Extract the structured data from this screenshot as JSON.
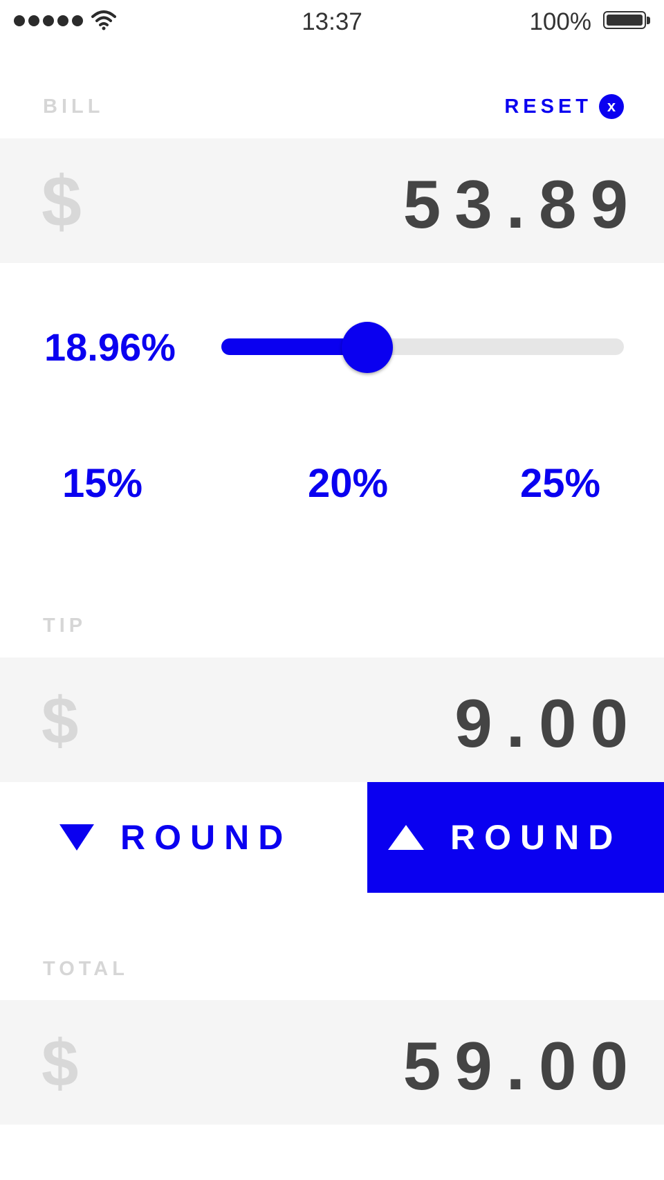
{
  "status_bar": {
    "time": "13:37",
    "battery_percent": "100%",
    "signal_bars": 5,
    "wifi_icon": "wifi-icon",
    "battery_icon": "battery-full-icon"
  },
  "bill": {
    "label": "BILL",
    "reset_label": "RESET",
    "reset_icon_glyph": "x",
    "currency_symbol": "$",
    "amount": "53.89"
  },
  "tip_slider": {
    "percent_label": "18.96%",
    "value_fraction": 0.3625
  },
  "presets": [
    {
      "label": "15%"
    },
    {
      "label": "20%"
    },
    {
      "label": "25%"
    }
  ],
  "tip": {
    "label": "TIP",
    "currency_symbol": "$",
    "amount": "9.00"
  },
  "round": {
    "down_label": "ROUND",
    "up_label": "ROUND",
    "active": "up"
  },
  "total": {
    "label": "TOTAL",
    "currency_symbol": "$",
    "amount": "59.00"
  },
  "colors": {
    "accent": "#0a00f0",
    "amount_text": "#444444",
    "muted_label": "#d6d6d6",
    "row_background": "#f5f5f5"
  }
}
